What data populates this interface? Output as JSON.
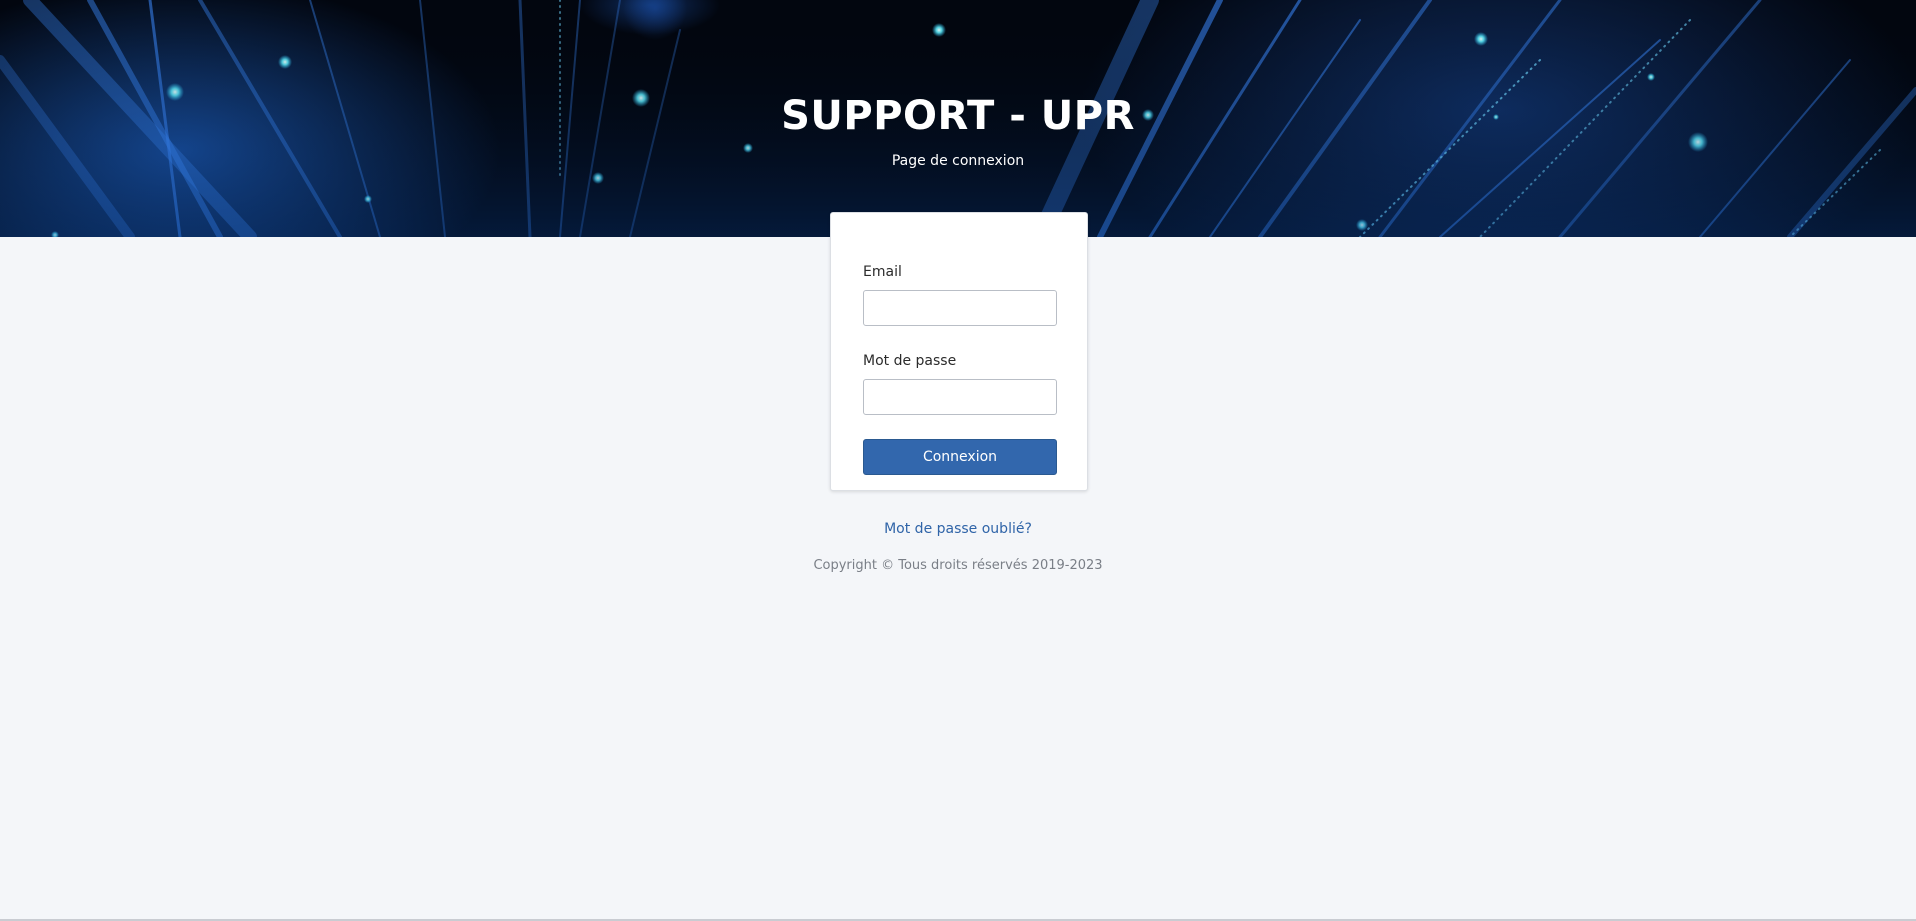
{
  "header": {
    "title": "SUPPORT - UPR",
    "subtitle": "Page de connexion"
  },
  "login_form": {
    "email_label": "Email",
    "email_value": "",
    "password_label": "Mot de passe",
    "password_value": "",
    "submit_label": "Connexion"
  },
  "footer": {
    "forgot_password_label": "Mot de passe oublié?",
    "copyright": "Copyright © Tous droits réservés 2019-2023"
  },
  "colors": {
    "hero_background": "#02060f",
    "page_background": "#f4f6f9",
    "primary_button": "#3267ad",
    "link": "#2f64a8"
  }
}
